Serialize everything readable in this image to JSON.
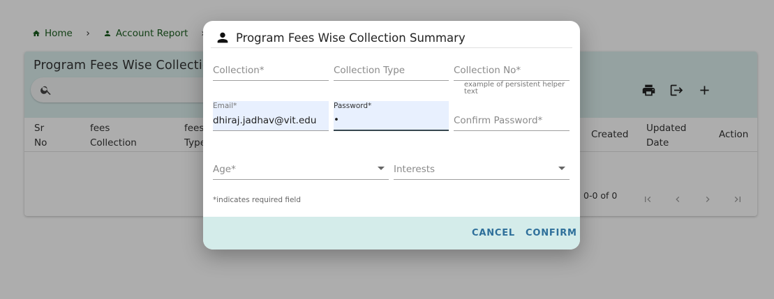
{
  "breadcrumb": {
    "home_icon": "home-icon",
    "home": "Home",
    "separator_icon": "chevron-right-icon",
    "account_icon": "person-icon",
    "account_report": "Account Report"
  },
  "card": {
    "title": "Program Fees Wise Collection Summary",
    "search_icon": "search-icon",
    "tool_icons": [
      "print-icon",
      "export-icon",
      "add-icon"
    ]
  },
  "table": {
    "columns": [
      {
        "line1": "Sr",
        "line2": "No"
      },
      {
        "line1": "fees",
        "line2": "Collection"
      },
      {
        "line1": "fees",
        "line2": "Type"
      },
      {
        "line1": "Created",
        "line2": ""
      },
      {
        "line1": "Updated",
        "line2": "Date"
      },
      {
        "line1": "Action",
        "line2": ""
      }
    ],
    "pagination": "0-0 of 0",
    "pager_icons": [
      "first-page-icon",
      "prev-page-icon",
      "next-page-icon",
      "last-page-icon"
    ]
  },
  "dialog": {
    "title_icon": "person-icon",
    "title": "Program Fees Wise Collection Summary",
    "fields": {
      "collection": {
        "label": "Collection*",
        "value": ""
      },
      "collection_type": {
        "label": "Collection Type",
        "value": ""
      },
      "collection_no": {
        "label": "Collection No*",
        "value": "",
        "helper": "example of persistent helper text"
      },
      "email": {
        "label": "Email*",
        "value": "dhiraj.jadhav@vit.edu"
      },
      "password": {
        "label": "Password*",
        "value": "•"
      },
      "confirm_password": {
        "label": "Confirm Password*",
        "value": ""
      },
      "age": {
        "label": "Age*",
        "value": ""
      },
      "interests": {
        "label": "Interests",
        "value": ""
      }
    },
    "required_note": "*indicates required field",
    "cancel": "CANCEL",
    "confirm": "CONFIRM",
    "colors": {
      "footer": "#d4ecea",
      "button_text": "#2e6f9a",
      "autofill": "#e8f0fe"
    }
  }
}
